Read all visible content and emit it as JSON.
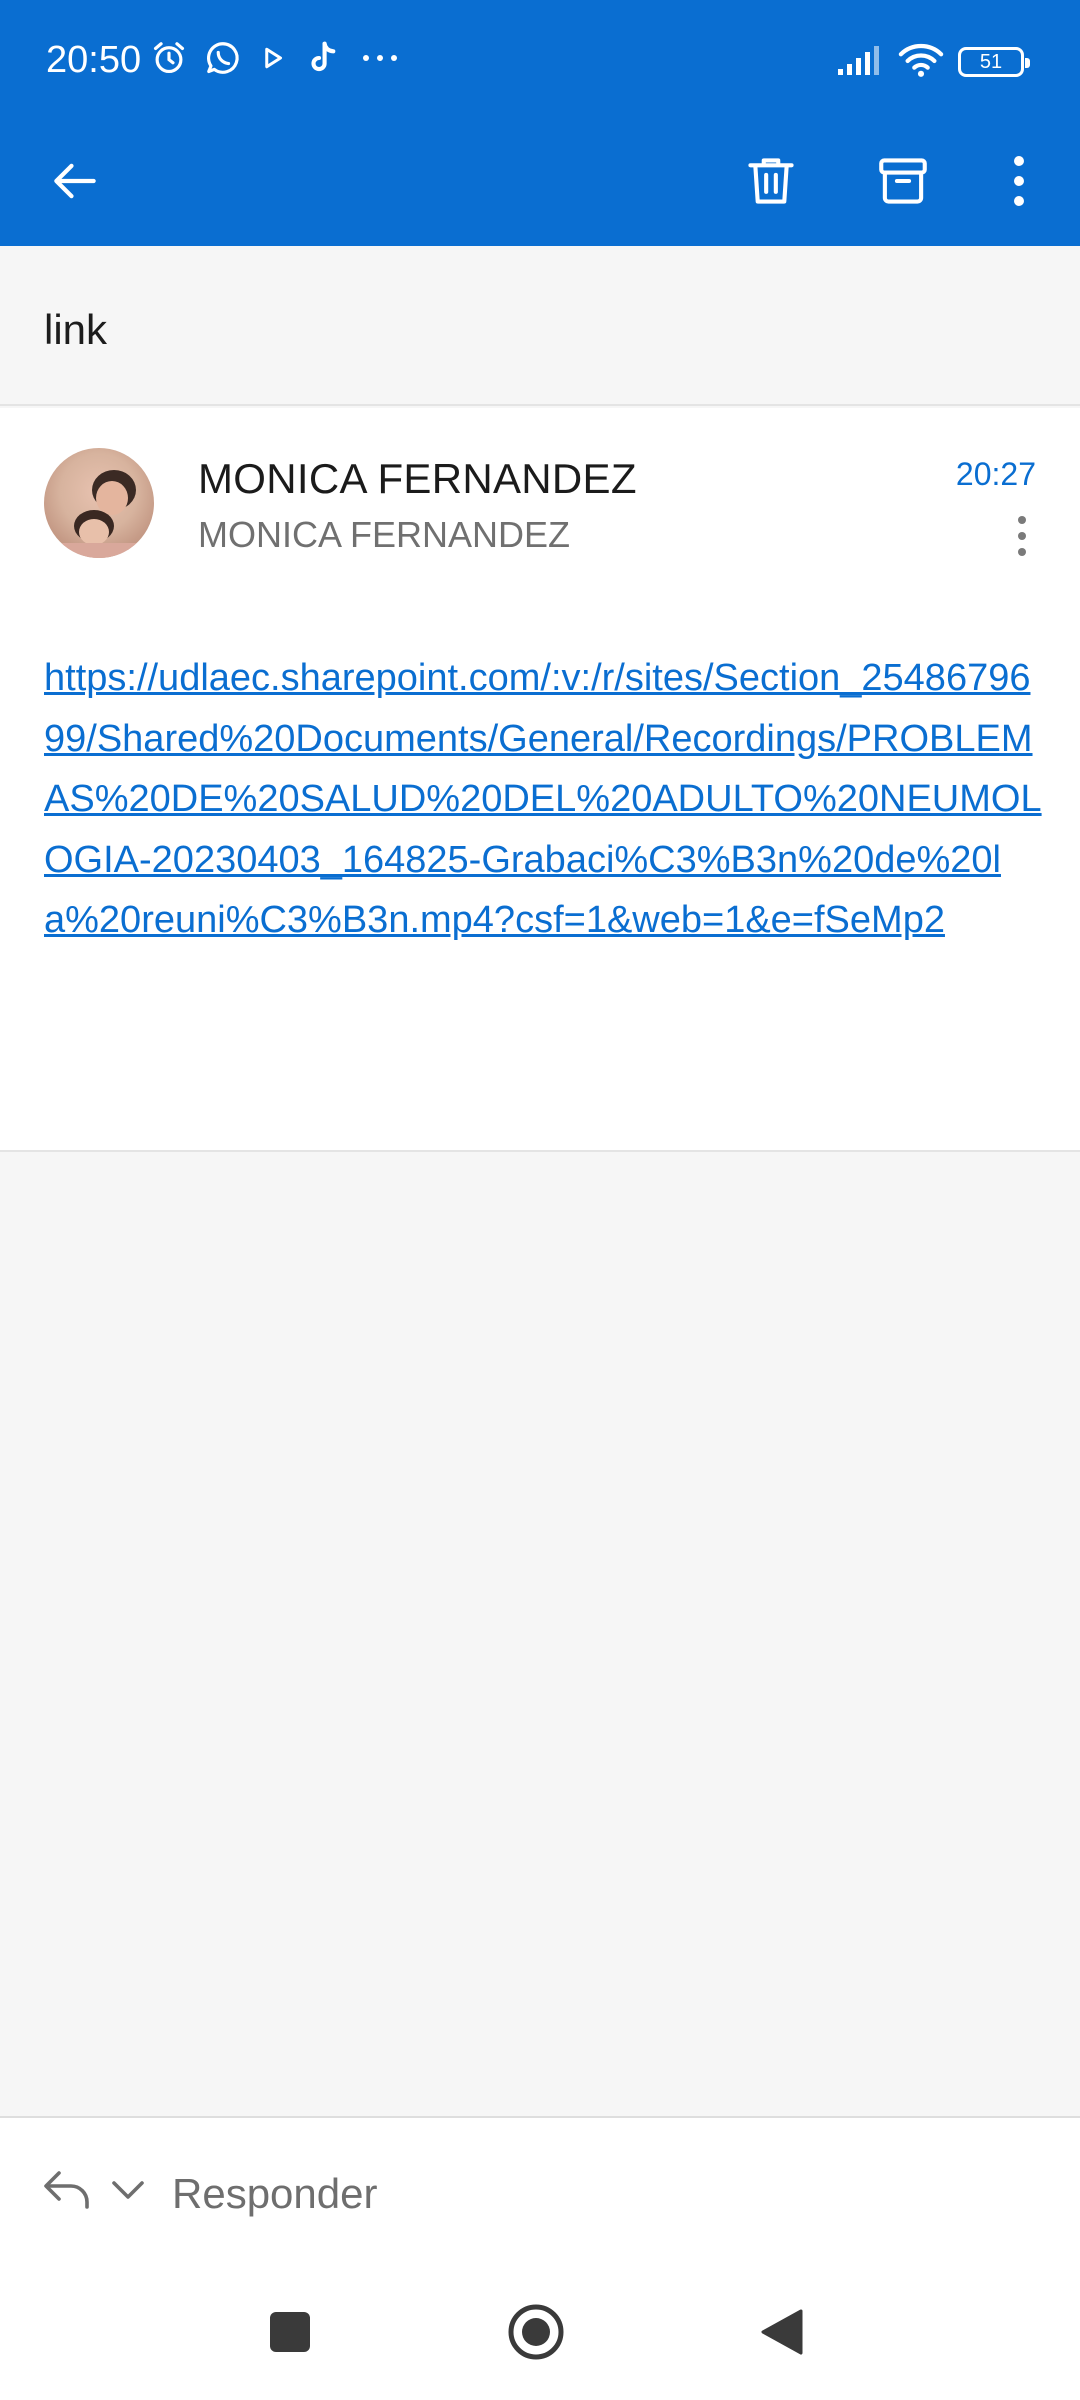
{
  "status_bar": {
    "time": "20:50",
    "battery_level": "51",
    "left_icons": [
      "alarm-icon",
      "whatsapp-icon",
      "play-icon",
      "tiktok-icon",
      "more-dots-icon"
    ],
    "right_icons": [
      "signal-icon",
      "wifi-icon",
      "battery-icon"
    ]
  },
  "toolbar": {
    "back_icon": "arrow-left-icon",
    "delete_icon": "trash-icon",
    "archive_icon": "archive-icon",
    "more_icon": "vertical-dots-icon"
  },
  "email": {
    "subject": "link",
    "sender_name": "MONICA FERNANDEZ",
    "sender_email": "MONICA FERNANDEZ",
    "time": "20:27",
    "body_link": "https://udlaec.sharepoint.com/:v:/r/sites/Section_2548679699/Shared%20Documents/General/Recordings/PROBLEMAS%20DE%20SALUD%20DEL%20ADULTO%20NEUMOLOGIA-20230403_164825-Grabaci%C3%B3n%20de%20la%20reuni%C3%B3n.mp4?csf=1&web=1&e=fSeMp2"
  },
  "reply": {
    "label": "Responder"
  },
  "colors": {
    "accent": "#0a6ed1",
    "background": "#f6f6f6",
    "card": "#ffffff"
  }
}
